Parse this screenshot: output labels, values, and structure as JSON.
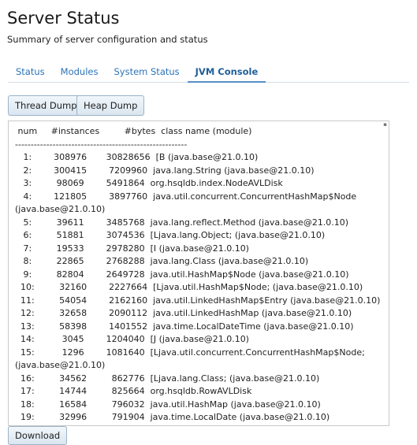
{
  "page": {
    "title": "Server Status",
    "subtitle": "Summary of server configuration and status"
  },
  "tabs": [
    {
      "label": "Status",
      "active": false
    },
    {
      "label": "Modules",
      "active": false
    },
    {
      "label": "System Status",
      "active": false
    },
    {
      "label": "JVM Console",
      "active": true
    }
  ],
  "toolbar": {
    "thread_dump_label": "Thread Dump",
    "heap_dump_label": "Heap Dump"
  },
  "console": {
    "lines": [
      " num     #instances         #bytes  class name (module)",
      "-------------------------------------------------------",
      "   1:        308976       30828656  [B (java.base@21.0.10)",
      "   2:        300415        7209960  java.lang.String (java.base@21.0.10)",
      "   3:         98069        5491864  org.hsqldb.index.NodeAVLDisk",
      "   4:        121805        3897760  java.util.concurrent.ConcurrentHashMap$Node",
      "(java.base@21.0.10)",
      "   5:         39611        3485768  java.lang.reflect.Method (java.base@21.0.10)",
      "   6:         51881        3074536  [Ljava.lang.Object; (java.base@21.0.10)",
      "   7:         19533        2978280  [I (java.base@21.0.10)",
      "   8:         22865        2768288  java.lang.Class (java.base@21.0.10)",
      "   9:         82804        2649728  java.util.HashMap$Node (java.base@21.0.10)",
      "  10:         32160        2227664  [Ljava.util.HashMap$Node; (java.base@21.0.10)",
      "  11:         54054        2162160  java.util.LinkedHashMap$Entry (java.base@21.0.10)",
      "  12:         32658        2090112  java.util.LinkedHashMap (java.base@21.0.10)",
      "  13:         58398        1401552  java.time.LocalDateTime (java.base@21.0.10)",
      "  14:          3045        1204040  [J (java.base@21.0.10)",
      "  15:          1296        1081640  [Ljava.util.concurrent.ConcurrentHashMap$Node;",
      "(java.base@21.0.10)",
      "  16:         34562         862776  [Ljava.lang.Class; (java.base@21.0.10)",
      "  17:         14744         825664  org.hsqldb.RowAVLDisk",
      "  18:         16584         796032  java.util.HashMap (java.base@21.0.10)",
      "  19:         32996         791904  java.time.LocalDate (java.base@21.0.10)"
    ]
  },
  "footer": {
    "download_label": "Download"
  }
}
